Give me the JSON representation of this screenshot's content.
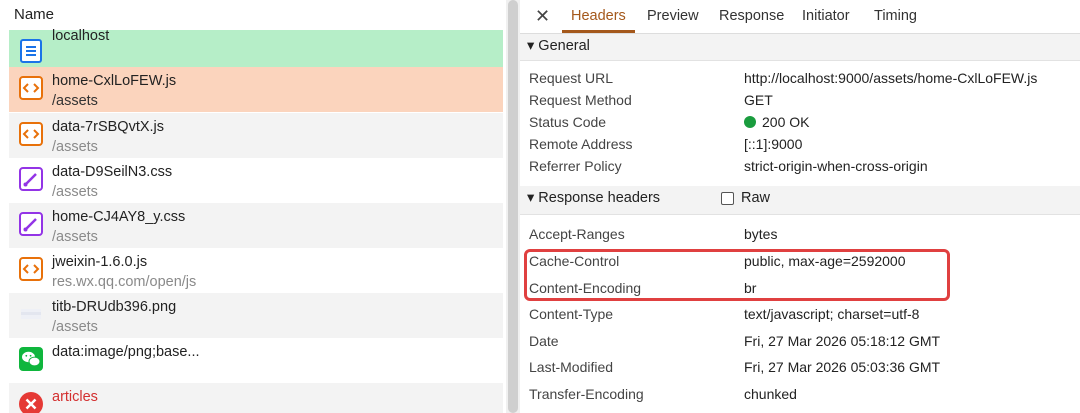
{
  "left": {
    "header": "Name",
    "rows": [
      {
        "name": "localhost",
        "path": "",
        "type": "doc",
        "bg": "#b6eec8"
      },
      {
        "name": "home-CxlLoFEW.js",
        "path": "/assets",
        "type": "script",
        "bg": "#fbd4bd"
      },
      {
        "name": "data-7rSBQvtX.js",
        "path": "/assets",
        "type": "script",
        "bg": "#f3f3f3"
      },
      {
        "name": "data-D9SeilN3.css",
        "path": "/assets",
        "type": "style",
        "bg": "#ffffff"
      },
      {
        "name": "home-CJ4AY8_y.css",
        "path": "/assets",
        "type": "style",
        "bg": "#f3f3f3"
      },
      {
        "name": "jweixin-1.6.0.js",
        "path": "res.wx.qq.com/open/js",
        "type": "script",
        "bg": "#ffffff"
      },
      {
        "name": "titb-DRUdb396.png",
        "path": "/assets",
        "type": "image",
        "bg": "#f3f3f3"
      },
      {
        "name": "data:image/png;base...",
        "path": "",
        "type": "wechat",
        "bg": "#ffffff"
      },
      {
        "name": "articles",
        "path": "",
        "type": "error",
        "bg": "#f3f3f3"
      }
    ]
  },
  "tabs": {
    "close": "✕",
    "items": [
      "Headers",
      "Preview",
      "Response",
      "Initiator",
      "Timing"
    ],
    "active": "Headers"
  },
  "general": {
    "title": "▾ General",
    "rows": [
      {
        "key": "Request URL",
        "value": "http://localhost:9000/assets/home-CxlLoFEW.js"
      },
      {
        "key": "Request Method",
        "value": "GET"
      },
      {
        "key": "Status Code",
        "value": "200 OK"
      },
      {
        "key": "Remote Address",
        "value": "[::1]:9000"
      },
      {
        "key": "Referrer Policy",
        "value": "strict-origin-when-cross-origin"
      }
    ]
  },
  "response": {
    "title": "▾ Response headers",
    "raw_label": "Raw",
    "rows": [
      {
        "key": "Accept-Ranges",
        "value": "bytes"
      },
      {
        "key": "Cache-Control",
        "value": "public, max-age=2592000"
      },
      {
        "key": "Content-Encoding",
        "value": "br"
      },
      {
        "key": "Content-Type",
        "value": "text/javascript; charset=utf-8"
      },
      {
        "key": "Date",
        "value": "Fri, 27 Mar 2026 05:18:12 GMT"
      },
      {
        "key": "Last-Modified",
        "value": "Fri, 27 Mar 2026 05:03:36 GMT"
      },
      {
        "key": "Transfer-Encoding",
        "value": "chunked"
      }
    ]
  }
}
